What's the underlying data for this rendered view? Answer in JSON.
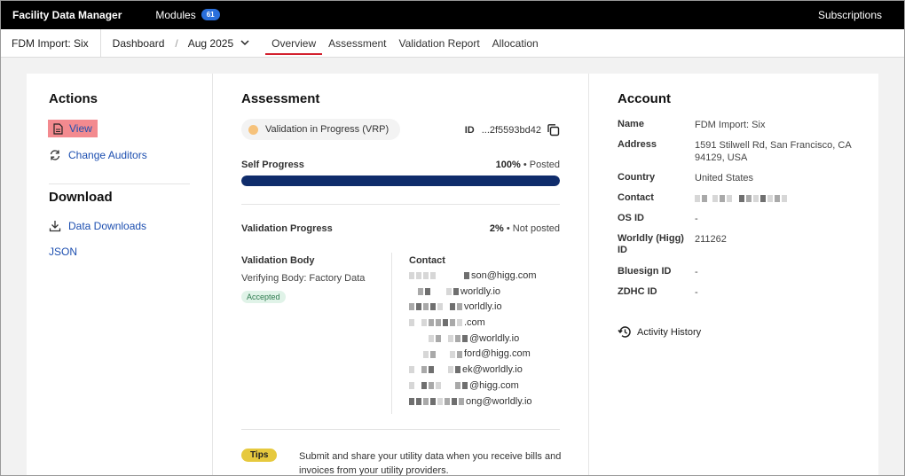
{
  "topbar": {
    "brand": "Facility Data Manager",
    "modules_label": "Modules",
    "modules_count": "61",
    "subscriptions": "Subscriptions"
  },
  "subnav": {
    "import_name": "FDM Import: Six",
    "crumb": "Dashboard",
    "period": "Aug 2025",
    "tabs": [
      {
        "label": "Overview",
        "active": true
      },
      {
        "label": "Assessment",
        "active": false
      },
      {
        "label": "Validation Report",
        "active": false
      },
      {
        "label": "Allocation",
        "active": false
      }
    ]
  },
  "actions": {
    "title": "Actions",
    "view": "View",
    "change_auditors": "Change Auditors"
  },
  "download": {
    "title": "Download",
    "data_downloads": "Data Downloads",
    "json": "JSON"
  },
  "assessment": {
    "title": "Assessment",
    "status": "Validation in Progress (VRP)",
    "id_label": "ID",
    "id_value": "...2f5593bd42",
    "self_progress_label": "Self Progress",
    "self_progress_pct": "100%",
    "self_progress_state": "Posted",
    "self_progress_value": 100,
    "validation_progress_label": "Validation Progress",
    "validation_progress_pct": "2%",
    "validation_progress_state": "Not posted",
    "validation_body_label": "Validation Body",
    "validation_body_value": "Verifying Body: Factory Data",
    "accepted": "Accepted",
    "contact_label": "Contact",
    "contacts": [
      "son@higg.com",
      "worldly.io",
      "vorldly.io",
      ".com",
      "@worldly.io",
      "ford@higg.com",
      "ek@worldly.io",
      "@higg.com",
      "ong@worldly.io"
    ],
    "tips_badge": "Tips",
    "tips_text": "Submit and share your utility data when you receive bills and invoices from your utility providers."
  },
  "account": {
    "title": "Account",
    "name_label": "Name",
    "name_value": "FDM Import: Six",
    "address_label": "Address",
    "address_value": "1591 Stilwell Rd, San Francisco, CA 94129, USA",
    "country_label": "Country",
    "country_value": "United States",
    "contact_label": "Contact",
    "osid_label": "OS ID",
    "osid_value": "-",
    "worldly_label": "Worldly (Higg) ID",
    "worldly_value": "211262",
    "bluesign_label": "Bluesign ID",
    "bluesign_value": "-",
    "zdhc_label": "ZDHC ID",
    "zdhc_value": "-",
    "activity_history": "Activity History"
  },
  "colors": {
    "accent_red": "#d3202e",
    "link_blue": "#1d4fb0",
    "progress_navy": "#0f2c6b",
    "highlight_pink": "#f38a8f"
  }
}
